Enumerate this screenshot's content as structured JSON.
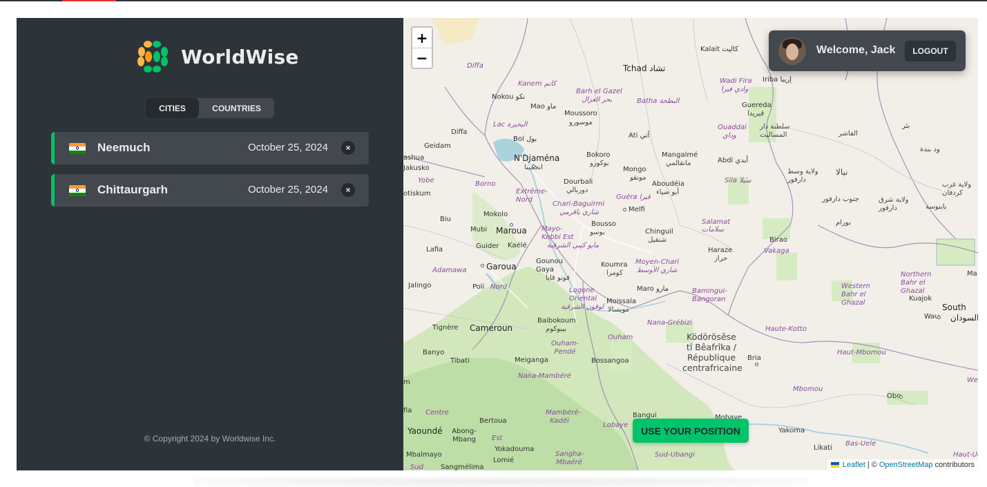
{
  "app": {
    "name": "WorldWise"
  },
  "tabs": [
    {
      "label": "CITIES",
      "active": true
    },
    {
      "label": "COUNTRIES",
      "active": false
    }
  ],
  "cities": [
    {
      "name": "Neemuch",
      "date": "October 25, 2024",
      "flag": "india-flag",
      "delete_label": "×"
    },
    {
      "name": "Chittaurgarh",
      "date": "October 25, 2024",
      "flag": "india-flag",
      "delete_label": "×"
    }
  ],
  "footer": {
    "copyright": "© Copyright 2024 by Worldwise Inc."
  },
  "user": {
    "welcome": "Welcome, Jack",
    "logout_label": "LOGOUT"
  },
  "map": {
    "zoom_in": "+",
    "zoom_out": "−",
    "position_button": "USE YOUR POSITION",
    "attribution": {
      "leaflet": "Leaflet",
      "separator": "| ©",
      "osm": "OpenStreetMap",
      "suffix": "contributors"
    },
    "labels": {
      "kalait": "Kalait كاليت",
      "tchad": "Tchad تشاد",
      "iriba": "Iriba إريبا",
      "wadi_fira": "Wadi Fira",
      "wadi_fira_ar": "وادي فيرا",
      "diffa_top": "Diffa",
      "kanem": "Kanem كانم",
      "barh_el_gazel": "Barh el Gazel",
      "barh_el_gazel_ar": "بحر الغزال",
      "batha": "Batha البطحة",
      "nokou": "Nokou نكو",
      "mao": "Mao ماو",
      "moussoro": "Moussoro",
      "moussoro_ar": "موسورو",
      "guereda": "Guereda",
      "guereda_ar": "قيريدا",
      "bir": "بئر",
      "diffa": "Diffa",
      "lac": "Lac البحيرة",
      "ouaddai": "Ouaddai",
      "ouaddai_ar": "وداي",
      "sultanate": "سلطنة دار المساليت",
      "al_fashir": "الفاشر",
      "geidam": "Geidam",
      "bol": "Bol بول",
      "ati": "Ati أتي",
      "wad_banda": "ود بندة",
      "ashua": "ashua",
      "ndjamena": "N'Djaména",
      "ndjamena_ar": "انجمينا",
      "bokoro": "Bokoro",
      "bokoro_ar": "بوكورو",
      "mangalme": "Mangalmé",
      "mangalme_ar": "مانقالمي",
      "abdi": "Abdi أبدي",
      "west_darfur": "ولاية وسط دارفور",
      "nyala": "نيالا",
      "jakusko": "Jakusko",
      "mongo": "Mongo",
      "mongo_ar": "مونقو",
      "sila": "Sila سيلا",
      "yobe": "Yobe",
      "borno": "Borno",
      "dourbali": "Dourbali",
      "dourbali_ar": "دوربالي",
      "aboudeia": "Aboudéia",
      "aboudeia_ar": "أبو ضياء",
      "west_kordofan": "ولاية غرب كردفان",
      "potiskum": "otiskum",
      "extreme_nord": "Extrême-Nord",
      "chari_baguirmi": "Chari-Baguirmi",
      "chari_baguirmi_ar": "شاري باقرمي",
      "guera": "Guéra قيرا",
      "melfi": "Melfi",
      "south_darfur": "جنوب دارفور",
      "east_darfur": "ولاية شرق دارفور",
      "babanusa": "بابنوسة",
      "biu": "Biu",
      "mokolo": "Mokolo",
      "salamat": "Salamat",
      "salamat_ar": "سلامات",
      "buram": "بورام",
      "mubi": "Mubi",
      "maroua": "Maroua",
      "mayo_kebbi": "Mayo-Kebbi Est",
      "mayo_kebbi_ar": "مايو كيبي الشرقية",
      "bousso": "Bousso",
      "bousso_ar": "بوسو",
      "chinguil": "Chinguil",
      "chinguil_ar": "شنقيل",
      "birao": "Birao",
      "lafia": "Lafia",
      "guider": "Guider",
      "kaele": "Kaélé",
      "haraze": "Haraze",
      "haraze_ar": "حراز",
      "vakaga": "Vakaga",
      "garoua": "Garoua",
      "gounou_gaya": "Gounou Gaya",
      "gounou_gaya_ar": "قونو قايا",
      "koumra": "Koumra",
      "koumra_ar": "كومرا",
      "moyen_chari": "Moyen-Chari",
      "moyen_chari_ar": "شاري الأوسط",
      "northern_bahr": "Northern Bahr el Ghazal",
      "adamawa": "Adamawa",
      "jalingo": "Jalingo",
      "poli": "Poli",
      "nord": "Nord",
      "logone": "Logone Oriental",
      "logone_ar": "لوقون الشرقية",
      "maro": "Maro مارو",
      "bamingui": "Bamingui-Bangoran",
      "western_bahr": "Western Bahr el Ghazal",
      "kuajok": "Kuajok",
      "south_sudan": "South",
      "south_sudan_ar": "السودان",
      "moissala": "Moissala",
      "moissala_ar": "مويسالا",
      "wau": "Wau",
      "baibokoum": "Baibokoum",
      "baibokoum_ar": "بيبوكوم",
      "nana_grebizi": "Nana-Grébizi",
      "tignere": "Tignère",
      "cameroun": "Cameroun",
      "haute_kotto": "Haute-Kotto",
      "ouham_pende": "Ouham-Pendé",
      "ouham": "Ouham",
      "car": "Ködörösêse tî Bêafrîka / République centrafricaine",
      "banyo": "Banyo",
      "tibati": "Tibati",
      "meiganga": "Meiganga",
      "bossangoa": "Bossangoa",
      "bria": "Bria",
      "haut_mbomou": "Haut-Mbomou",
      "nana_mambere": "Nana-Mambéré",
      "mbomou": "Mbomou",
      "obo": "Obo",
      "centre": "Centre",
      "mambere_kadei": "Mambéré-Kadéï",
      "bertoua": "Bertoua",
      "lobaye": "Lobaye",
      "bangui": "Bangui",
      "mobaye": "Mobaye",
      "yakoma": "Yakoma",
      "yaounde": "Yaoundé",
      "abong_mbang": "Abong-Mbang",
      "est": "Est",
      "yokadouma": "Yokadouma",
      "bas_uele": "Bas-Uele",
      "sud_ubangi": "Sud-Ubangi",
      "likati": "Likati",
      "mbalmayo": "Mbalmayo",
      "lomie": "Lomié",
      "sangha_mbaere": "Sangha-Mbaéré",
      "sangmelima": "Sangmélima",
      "haut_uele": "Haut-Uele",
      "west_edge": "Wes",
      "ma_edge": "Ma",
      "sud": "Sud",
      "fia": "fia",
      "m_edge": "m"
    }
  },
  "colors": {
    "sidebar": "#2d3439",
    "panel": "#42484d",
    "accent": "#00c46a",
    "text": "#ececec"
  }
}
